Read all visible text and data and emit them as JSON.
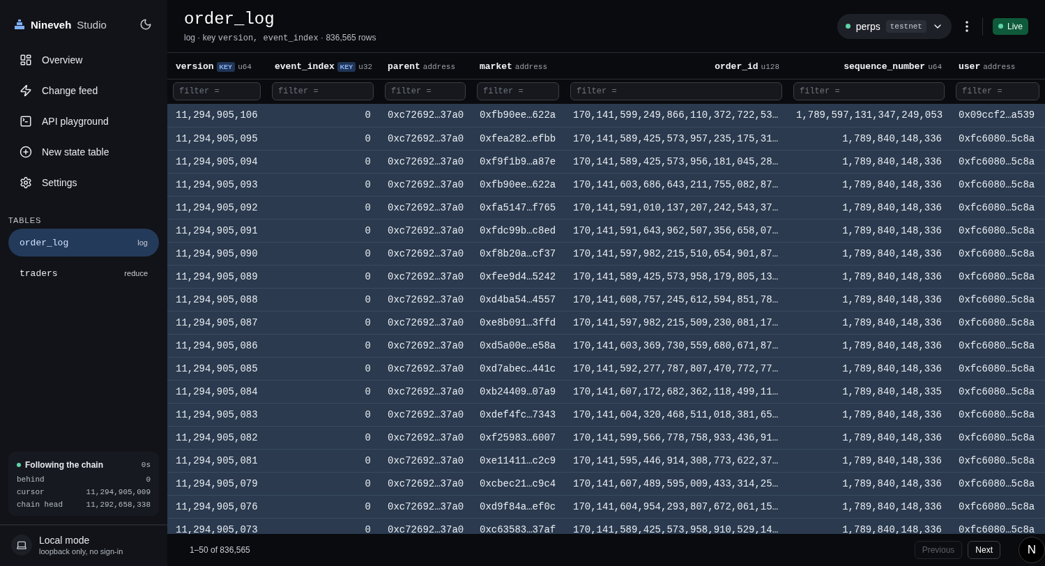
{
  "brand": {
    "name": "Nineveh",
    "suffix": "Studio"
  },
  "nav": [
    {
      "label": "Overview"
    },
    {
      "label": "Change feed"
    },
    {
      "label": "API playground"
    },
    {
      "label": "New state table"
    },
    {
      "label": "Settings"
    }
  ],
  "tables_heading": "TABLES",
  "tables": [
    {
      "name": "order_log",
      "kind": "log",
      "selected": true
    },
    {
      "name": "traders",
      "kind": "reduce",
      "selected": false
    }
  ],
  "sync": {
    "title": "Following the chain",
    "age": "0s",
    "color": "#5fd4a8",
    "rows": [
      {
        "label": "behind",
        "value": "0"
      },
      {
        "label": "cursor",
        "value": "11,294,905,009"
      },
      {
        "label": "chain head",
        "value": "11,292,658,338"
      }
    ]
  },
  "mode": {
    "title": "Local mode",
    "subtitle": "loopback only, no sign-in"
  },
  "header": {
    "title": "order_log",
    "subtitle_parts": [
      "log · key ",
      "version,  event_index",
      " · 836,565 rows"
    ]
  },
  "network": {
    "name": "perps",
    "env": "testnet",
    "color": "#5fd4a8"
  },
  "live": {
    "label": "Live",
    "color": "#5fd4a8"
  },
  "columns": [
    {
      "name": "version",
      "key": "KEY",
      "type": "u64",
      "placeholder": "filter ="
    },
    {
      "name": "event_index",
      "key": "KEY",
      "type": "u32",
      "placeholder": "filter ="
    },
    {
      "name": "parent",
      "type": "address",
      "placeholder": "filter ="
    },
    {
      "name": "market",
      "type": "address",
      "placeholder": "filter ="
    },
    {
      "name": "order_id",
      "type": "u128",
      "placeholder": "filter ="
    },
    {
      "name": "sequence_number",
      "type": "u64",
      "placeholder": "filter ="
    },
    {
      "name": "user",
      "type": "address",
      "placeholder": "filter ="
    }
  ],
  "rows": [
    [
      "11,294,905,106",
      "0",
      "0xc72692…37a0",
      "0xfb90ee…622a",
      "170,141,599,249,866,110,372,722,53…",
      "1,789,597,131,347,249,053",
      "0x09ccf2…a539"
    ],
    [
      "11,294,905,095",
      "0",
      "0xc72692…37a0",
      "0xfea282…efbb",
      "170,141,589,425,573,957,235,175,31…",
      "1,789,840,148,336",
      "0xfc6080…5c8a"
    ],
    [
      "11,294,905,094",
      "0",
      "0xc72692…37a0",
      "0xf9f1b9…a87e",
      "170,141,589,425,573,956,181,045,28…",
      "1,789,840,148,336",
      "0xfc6080…5c8a"
    ],
    [
      "11,294,905,093",
      "0",
      "0xc72692…37a0",
      "0xfb90ee…622a",
      "170,141,603,686,643,211,755,082,87…",
      "1,789,840,148,336",
      "0xfc6080…5c8a"
    ],
    [
      "11,294,905,092",
      "0",
      "0xc72692…37a0",
      "0xfa5147…f765",
      "170,141,591,010,137,207,242,543,37…",
      "1,789,840,148,336",
      "0xfc6080…5c8a"
    ],
    [
      "11,294,905,091",
      "0",
      "0xc72692…37a0",
      "0xfdc99b…c8ed",
      "170,141,591,643,962,507,356,658,07…",
      "1,789,840,148,336",
      "0xfc6080…5c8a"
    ],
    [
      "11,294,905,090",
      "0",
      "0xc72692…37a0",
      "0xf8b20a…cf37",
      "170,141,597,982,215,510,654,901,87…",
      "1,789,840,148,336",
      "0xfc6080…5c8a"
    ],
    [
      "11,294,905,089",
      "0",
      "0xc72692…37a0",
      "0xfee9d4…5242",
      "170,141,589,425,573,958,179,805,13…",
      "1,789,840,148,336",
      "0xfc6080…5c8a"
    ],
    [
      "11,294,905,088",
      "0",
      "0xc72692…37a0",
      "0xd4ba54…4557",
      "170,141,608,757,245,612,594,851,78…",
      "1,789,840,148,336",
      "0xfc6080…5c8a"
    ],
    [
      "11,294,905,087",
      "0",
      "0xc72692…37a0",
      "0xe8b091…3ffd",
      "170,141,597,982,215,509,230,081,17…",
      "1,789,840,148,336",
      "0xfc6080…5c8a"
    ],
    [
      "11,294,905,086",
      "0",
      "0xc72692…37a0",
      "0xd5a00e…e58a",
      "170,141,603,369,730,559,680,671,87…",
      "1,789,840,148,336",
      "0xfc6080…5c8a"
    ],
    [
      "11,294,905,085",
      "0",
      "0xc72692…37a0",
      "0xd7abec…441c",
      "170,141,592,277,787,807,470,772,77…",
      "1,789,840,148,336",
      "0xfc6080…5c8a"
    ],
    [
      "11,294,905,084",
      "0",
      "0xc72692…37a0",
      "0xb24409…07a9",
      "170,141,607,172,682,362,118,499,11…",
      "1,789,840,148,335",
      "0xfc6080…5c8a"
    ],
    [
      "11,294,905,083",
      "0",
      "0xc72692…37a0",
      "0xdef4fc…7343",
      "170,141,604,320,468,511,018,381,65…",
      "1,789,840,148,336",
      "0xfc6080…5c8a"
    ],
    [
      "11,294,905,082",
      "0",
      "0xc72692…37a0",
      "0xf25983…6007",
      "170,141,599,566,778,758,933,436,91…",
      "1,789,840,148,336",
      "0xfc6080…5c8a"
    ],
    [
      "11,294,905,081",
      "0",
      "0xc72692…37a0",
      "0xe11411…c2c9",
      "170,141,595,446,914,308,773,622,37…",
      "1,789,840,148,336",
      "0xfc6080…5c8a"
    ],
    [
      "11,294,905,079",
      "0",
      "0xc72692…37a0",
      "0xcbec21…c9c4",
      "170,141,607,489,595,009,433,314,25…",
      "1,789,840,148,336",
      "0xfc6080…5c8a"
    ],
    [
      "11,294,905,076",
      "0",
      "0xc72692…37a0",
      "0xd9f84a…ef0c",
      "170,141,604,954,293,807,672,061,15…",
      "1,789,840,148,336",
      "0xfc6080…5c8a"
    ],
    [
      "11,294,905,073",
      "0",
      "0xc72692…37a0",
      "0xc63583…37af",
      "170,141,589,425,573,958,910,529,14…",
      "1,789,840,148,336",
      "0xfc6080…5c8a"
    ]
  ],
  "pagination": {
    "range": "1–50 of 836,565",
    "previous": {
      "label": "Previous",
      "disabled": true
    },
    "next": {
      "label": "Next",
      "disabled": false
    }
  },
  "dev_badge": "N"
}
